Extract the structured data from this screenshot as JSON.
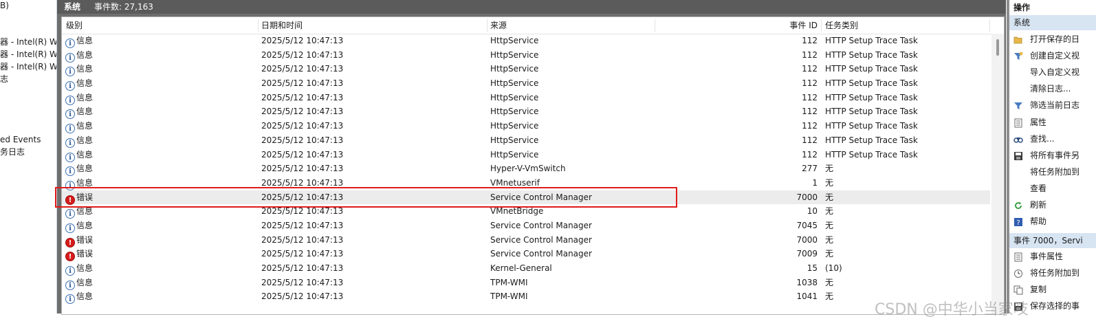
{
  "left_tree": {
    "items": [
      "器 - Intel(R) W",
      "器 - Intel(R) W",
      "器 - Intel(R) W",
      "志",
      "ed Events",
      "务日志"
    ],
    "top_fragment": "B)"
  },
  "log_header": {
    "title": "系统",
    "event_count": "事件数: 27,163"
  },
  "columns": [
    "级别",
    "日期和时间",
    "来源",
    "事件 ID",
    "任务类别"
  ],
  "rows": [
    {
      "level": "信息",
      "type": "info",
      "date": "2025/5/12 10:47:13",
      "source": "HttpService",
      "id": "112",
      "task": "HTTP Setup Trace Task"
    },
    {
      "level": "信息",
      "type": "info",
      "date": "2025/5/12 10:47:13",
      "source": "HttpService",
      "id": "112",
      "task": "HTTP Setup Trace Task"
    },
    {
      "level": "信息",
      "type": "info",
      "date": "2025/5/12 10:47:13",
      "source": "HttpService",
      "id": "112",
      "task": "HTTP Setup Trace Task"
    },
    {
      "level": "信息",
      "type": "info",
      "date": "2025/5/12 10:47:13",
      "source": "HttpService",
      "id": "112",
      "task": "HTTP Setup Trace Task"
    },
    {
      "level": "信息",
      "type": "info",
      "date": "2025/5/12 10:47:13",
      "source": "HttpService",
      "id": "112",
      "task": "HTTP Setup Trace Task"
    },
    {
      "level": "信息",
      "type": "info",
      "date": "2025/5/12 10:47:13",
      "source": "HttpService",
      "id": "112",
      "task": "HTTP Setup Trace Task"
    },
    {
      "level": "信息",
      "type": "info",
      "date": "2025/5/12 10:47:13",
      "source": "HttpService",
      "id": "112",
      "task": "HTTP Setup Trace Task"
    },
    {
      "level": "信息",
      "type": "info",
      "date": "2025/5/12 10:47:13",
      "source": "HttpService",
      "id": "112",
      "task": "HTTP Setup Trace Task"
    },
    {
      "level": "信息",
      "type": "info",
      "date": "2025/5/12 10:47:13",
      "source": "HttpService",
      "id": "112",
      "task": "HTTP Setup Trace Task"
    },
    {
      "level": "信息",
      "type": "info",
      "date": "2025/5/12 10:47:13",
      "source": "Hyper-V-VmSwitch",
      "id": "277",
      "task": "无"
    },
    {
      "level": "信息",
      "type": "info",
      "date": "2025/5/12 10:47:13",
      "source": "VMnetuserif",
      "id": "1",
      "task": "无"
    },
    {
      "level": "错误",
      "type": "error",
      "date": "2025/5/12 10:47:13",
      "source": "Service Control Manager",
      "id": "7000",
      "task": "无",
      "selected": true
    },
    {
      "level": "信息",
      "type": "info",
      "date": "2025/5/12 10:47:13",
      "source": "VMnetBridge",
      "id": "10",
      "task": "无"
    },
    {
      "level": "信息",
      "type": "info",
      "date": "2025/5/12 10:47:13",
      "source": "Service Control Manager",
      "id": "7045",
      "task": "无"
    },
    {
      "level": "错误",
      "type": "error",
      "date": "2025/5/12 10:47:13",
      "source": "Service Control Manager",
      "id": "7000",
      "task": "无"
    },
    {
      "level": "错误",
      "type": "error",
      "date": "2025/5/12 10:47:13",
      "source": "Service Control Manager",
      "id": "7009",
      "task": "无"
    },
    {
      "level": "信息",
      "type": "info",
      "date": "2025/5/12 10:47:13",
      "source": "Kernel-General",
      "id": "15",
      "task": "(10)"
    },
    {
      "level": "信息",
      "type": "info",
      "date": "2025/5/12 10:47:13",
      "source": "TPM-WMI",
      "id": "1038",
      "task": "无"
    },
    {
      "level": "信息",
      "type": "info",
      "date": "2025/5/12 10:47:13",
      "source": "TPM-WMI",
      "id": "1041",
      "task": "无"
    }
  ],
  "actions": {
    "title": "操作",
    "section_system": "系统",
    "items": [
      {
        "label": "打开保存的日",
        "icon": "folder-open-icon"
      },
      {
        "label": "创建自定义视",
        "icon": "filter-create-icon"
      },
      {
        "label": "导入自定义视",
        "icon": ""
      },
      {
        "label": "清除日志...",
        "icon": ""
      },
      {
        "label": "筛选当前日志",
        "icon": "filter-icon"
      },
      {
        "label": "属性",
        "icon": "properties-icon"
      },
      {
        "label": "查找...",
        "icon": "find-icon"
      },
      {
        "label": "将所有事件另",
        "icon": "save-icon"
      },
      {
        "label": "将任务附加到",
        "icon": ""
      },
      {
        "label": "查看",
        "icon": ""
      },
      {
        "label": "刷新",
        "icon": "refresh-icon"
      },
      {
        "label": "帮助",
        "icon": "help-icon"
      }
    ],
    "section_event": "事件 7000，Servi",
    "event_items": [
      {
        "label": "事件属性",
        "icon": "properties-icon"
      },
      {
        "label": "将任务附加到",
        "icon": "task-icon"
      },
      {
        "label": "复制",
        "icon": "copy-icon"
      },
      {
        "label": "保存选择的事",
        "icon": "save-icon"
      }
    ]
  },
  "watermark": "CSDN @中华小当家吱",
  "colors": {
    "error": "#d71c1c",
    "info": "#3a6fb0",
    "highlight": "#e01a1a",
    "section_bg": "#d7e4f2"
  }
}
